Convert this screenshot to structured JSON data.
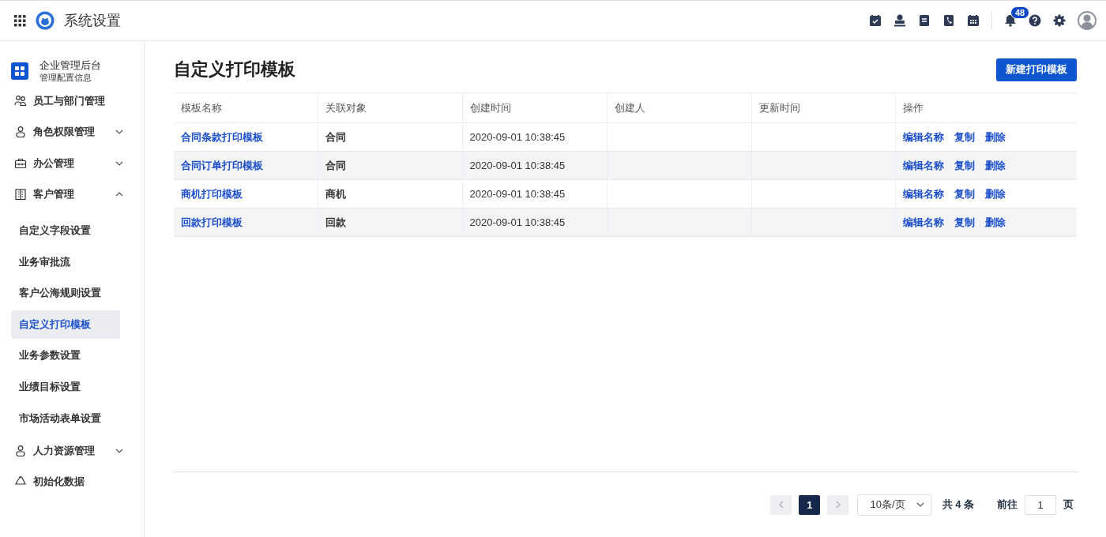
{
  "header": {
    "title": "系统设置",
    "notification_count": "48"
  },
  "sidebar": {
    "org": {
      "name": "企业管理后台",
      "subtitle": "管理配置信息"
    },
    "items": [
      {
        "label": "员工与部门管理"
      },
      {
        "label": "角色权限管理",
        "expanded": false
      },
      {
        "label": "办公管理",
        "expanded": false
      },
      {
        "label": "客户管理",
        "expanded": true,
        "children": [
          {
            "label": "自定义字段设置",
            "selected": false
          },
          {
            "label": "业务审批流",
            "selected": false
          },
          {
            "label": "客户公海规则设置",
            "selected": false
          },
          {
            "label": "自定义打印模板",
            "selected": true
          },
          {
            "label": "业务参数设置",
            "selected": false
          },
          {
            "label": "业绩目标设置",
            "selected": false
          },
          {
            "label": "市场活动表单设置",
            "selected": false
          }
        ]
      },
      {
        "label": "人力资源管理",
        "expanded": false
      },
      {
        "label": "初始化数据"
      }
    ]
  },
  "page": {
    "title": "自定义打印模板",
    "new_button": "新建打印模板"
  },
  "table": {
    "columns": [
      "模板名称",
      "关联对象",
      "创建时间",
      "创建人",
      "更新时间",
      "操作"
    ],
    "rows": [
      {
        "name": "合同条款打印模板",
        "object": "合同",
        "created": "2020-09-01 10:38:45",
        "actions": [
          "编辑名称",
          "复制",
          "删除"
        ]
      },
      {
        "name": "合同订单打印模板",
        "object": "合同",
        "created": "2020-09-01 10:38:45",
        "actions": [
          "编辑名称",
          "复制",
          "删除"
        ]
      },
      {
        "name": "商机打印模板",
        "object": "商机",
        "created": "2020-09-01 10:38:45",
        "actions": [
          "编辑名称",
          "复制",
          "删除"
        ]
      },
      {
        "name": "回款打印模板",
        "object": "回款",
        "created": "2020-09-01 10:38:45",
        "actions": [
          "编辑名称",
          "复制",
          "删除"
        ]
      }
    ]
  },
  "pagination": {
    "prev_disabled": true,
    "next_disabled": true,
    "pages": [
      {
        "label": "1",
        "selected": true
      }
    ],
    "page_size": "10条/页",
    "total": "共 4 条",
    "goto_label": "前往",
    "goto_value": "1",
    "goto_suffix": "页"
  }
}
